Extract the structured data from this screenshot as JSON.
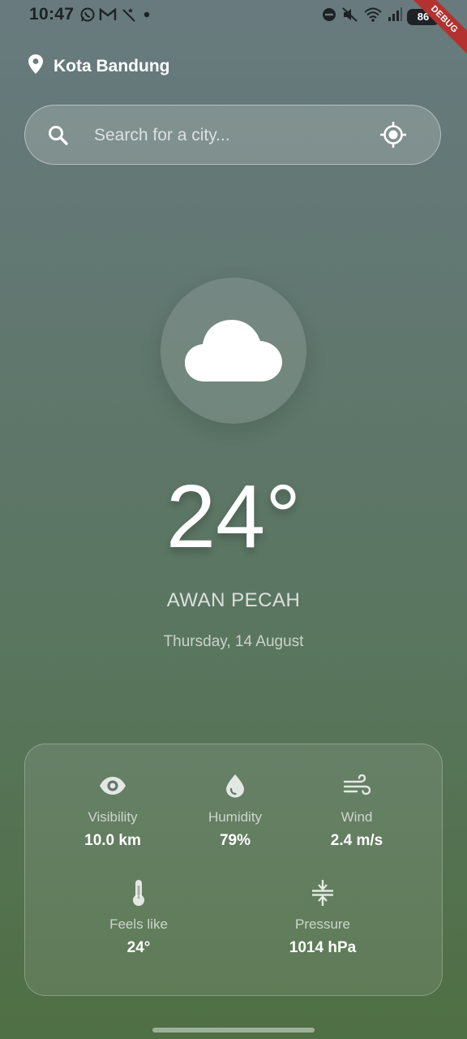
{
  "status_bar": {
    "time": "10:47",
    "battery": "86",
    "left_icons": [
      "whatsapp-icon",
      "gmail-icon",
      "magic-wand-icon",
      "dot-icon"
    ],
    "right_icons": [
      "do-not-disturb-icon",
      "mute-icon",
      "wifi-icon",
      "signal-icon",
      "battery-icon"
    ]
  },
  "debug_banner": "DEBUG",
  "location": {
    "icon": "location-pin-icon",
    "name": "Kota Bandung"
  },
  "search": {
    "placeholder": "Search for a city...",
    "value": "",
    "search_icon": "search-icon",
    "locate_icon": "my-location-icon"
  },
  "weather": {
    "icon": "cloud-icon",
    "temperature": "24°",
    "condition": "AWAN PECAH",
    "date": "Thursday, 14 August"
  },
  "details": {
    "visibility": {
      "icon": "eye-icon",
      "label": "Visibility",
      "value": "10.0 km"
    },
    "humidity": {
      "icon": "water-drop-icon",
      "label": "Humidity",
      "value": "79%"
    },
    "wind": {
      "icon": "wind-icon",
      "label": "Wind",
      "value": "2.4 m/s"
    },
    "feels_like": {
      "icon": "thermometer-icon",
      "label": "Feels like",
      "value": "24°"
    },
    "pressure": {
      "icon": "pressure-icon",
      "label": "Pressure",
      "value": "1014 hPa"
    }
  },
  "colors": {
    "gradient_top": "#687a7e",
    "gradient_bottom": "#4f6f44",
    "debug_banner": "#b3322f",
    "text": "#ffffff"
  }
}
